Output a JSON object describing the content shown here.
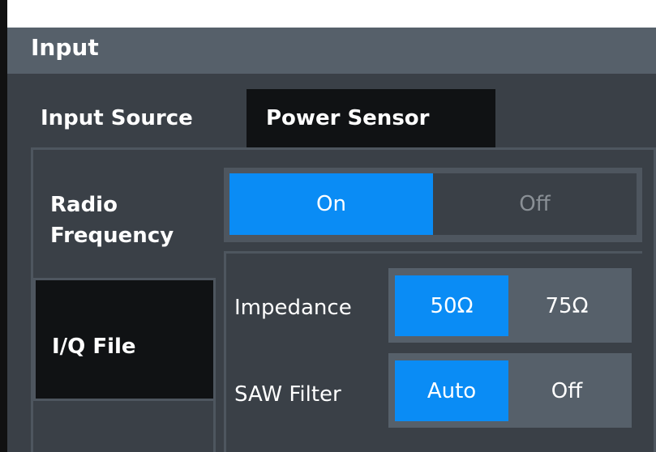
{
  "dialog": {
    "title": "Input"
  },
  "tabs": [
    {
      "label": "Input Source",
      "active": true
    },
    {
      "label": "Power Sensor",
      "active": false
    }
  ],
  "nav": {
    "radio_frequency": {
      "line1": "Radio",
      "line2": "Frequency"
    },
    "iq_file": "I/Q File"
  },
  "rf_toggle": {
    "on_label": "On",
    "off_label": "Off",
    "selected": "On"
  },
  "impedance": {
    "label": "Impedance",
    "options": [
      "50Ω",
      "75Ω"
    ],
    "selected": "50Ω"
  },
  "saw_filter": {
    "label": "SAW Filter",
    "options": [
      "Auto",
      "Off"
    ],
    "selected": "Auto"
  },
  "colors": {
    "accent": "#0a8cf5",
    "panel": "#3a4047",
    "titlebar": "#56606a",
    "tab_inactive": "#101214"
  }
}
